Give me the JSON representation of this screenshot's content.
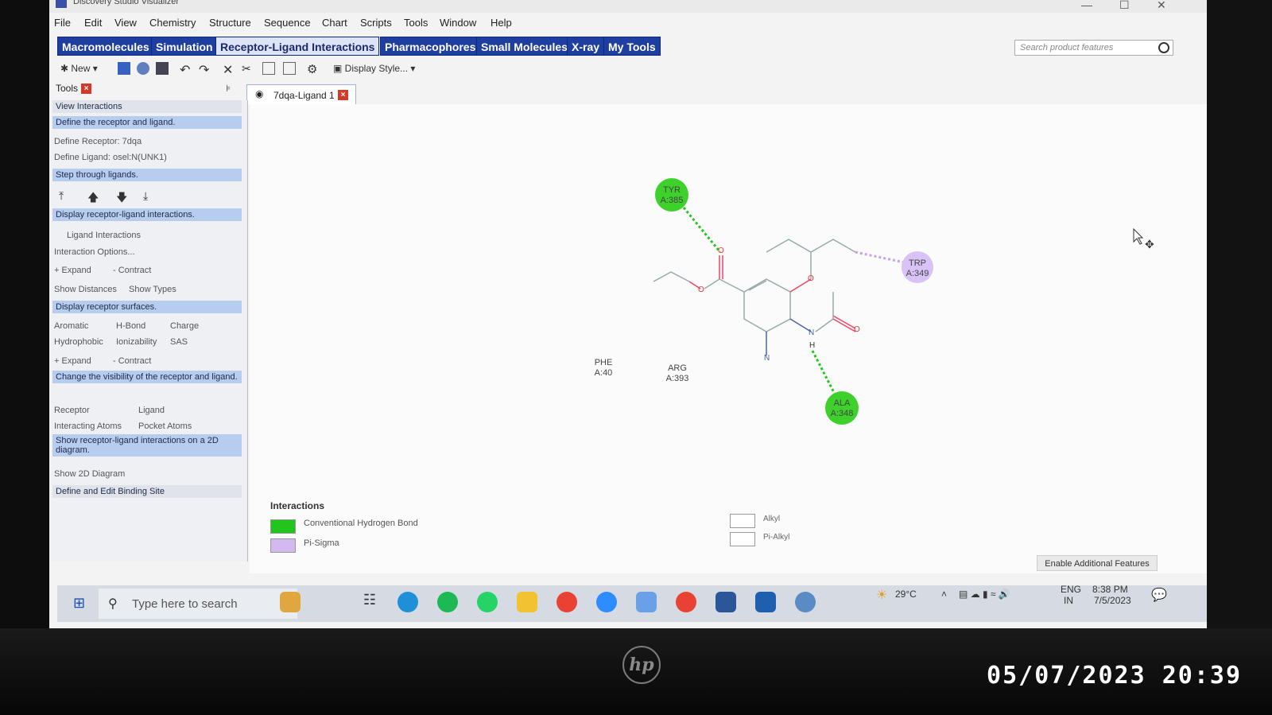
{
  "window": {
    "title": "Discovery Studio Visualizer"
  },
  "menu": [
    "File",
    "Edit",
    "View",
    "Chemistry",
    "Structure",
    "Sequence",
    "Chart",
    "Scripts",
    "Tools",
    "Window",
    "Help"
  ],
  "ribbon_tabs": [
    "Macromolecules",
    "Simulation",
    "Receptor-Ligand Interactions",
    "Pharmacophores",
    "Small Molecules",
    "X-ray",
    "My Tools"
  ],
  "search": {
    "placeholder": "Search product features"
  },
  "toolbar": {
    "new_label": "New",
    "display_style_label": "Display Style..."
  },
  "tools_panel": {
    "tab_label": "Tools",
    "header": "View Interactions",
    "define_section": "Define the receptor and ligand.",
    "define_receptor": "Define Receptor: 7dqa",
    "define_ligand": "Define Ligand: osel:N(UNK1)",
    "step_section": "Step through ligands.",
    "display_section": "Display receptor-ligand interactions.",
    "ligand_interactions": "Ligand Interactions",
    "interaction_options": "Interaction Options...",
    "expand": "+ Expand",
    "contract": "- Contract",
    "show_distances": "Show Distances",
    "show_types": "Show Types",
    "surfaces_section": "Display receptor surfaces.",
    "surf_aromatic": "Aromatic",
    "surf_hbond": "H-Bond",
    "surf_charge": "Charge",
    "surf_hydrophobic": "Hydrophobic",
    "surf_ionizability": "Ionizability",
    "surf_sas": "SAS",
    "visibility_section": "Change the visibility of the receptor and ligand.",
    "vis_receptor": "Receptor",
    "vis_ligand": "Ligand",
    "vis_interacting_atoms": "Interacting Atoms",
    "vis_pocket_atoms": "Pocket Atoms",
    "diagram_section": "Show receptor-ligand interactions on a 2D diagram.",
    "show_2d_diagram": "Show 2D Diagram",
    "binding_site_section": "Define and Edit Binding Site"
  },
  "document_tab": {
    "label": "7dqa-Ligand 1"
  },
  "diagram": {
    "residues": [
      {
        "name": "TYR",
        "chain": "A:385",
        "type": "hbond"
      },
      {
        "name": "TRP",
        "chain": "A:349",
        "type": "pi-sigma"
      },
      {
        "name": "ALA",
        "chain": "A:348",
        "type": "hbond"
      },
      {
        "name": "PHE",
        "chain": "A:40",
        "type": "none"
      },
      {
        "name": "ARG",
        "chain": "A:393",
        "type": "none"
      }
    ],
    "atom_labels": {
      "o1": "O",
      "o2": "O",
      "o3": "O",
      "o4": "O",
      "n1": "N",
      "h1": "H",
      "n2": "N"
    }
  },
  "legend": {
    "title": "Interactions",
    "items": [
      {
        "label": "Conventional Hydrogen Bond",
        "color": "#22c51b"
      },
      {
        "label": "Pi-Sigma",
        "color": "#d4b8f0"
      },
      {
        "label": "Alkyl",
        "color": "#ffffff"
      },
      {
        "label": "Pi-Alkyl",
        "color": "#ffffff"
      }
    ]
  },
  "enable_features": "Enable Additional Features",
  "taskbar": {
    "search_placeholder": "Type here to search",
    "weather": "29°C",
    "lang": "ENG",
    "region": "IN",
    "time": "8:38 PM",
    "date": "7/5/2023"
  },
  "photo_timestamp": "05/07/2023 20:39",
  "colors": {
    "ribbon": "#1f3fa0",
    "hbond": "#22c51b",
    "pisigma": "#d4b8f0",
    "section": "#b7cdf0"
  }
}
